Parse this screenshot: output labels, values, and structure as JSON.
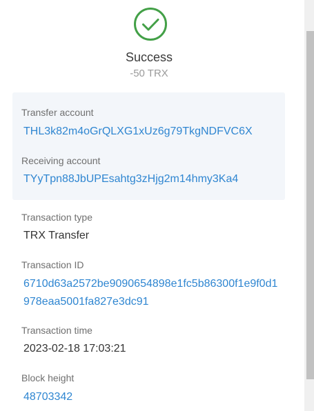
{
  "status": {
    "icon": "check-circle-icon",
    "title": "Success",
    "amount": "-50 TRX",
    "color": "#43a047"
  },
  "accounts": {
    "transfer_label": "Transfer account",
    "transfer_value": "THL3k82m4oGrQLXG1xUz6g79TkgNDFVC6X",
    "receiving_label": "Receiving account",
    "receiving_value": "TYyTpn88JbUPEsahtg3zHjg2m14hmy3Ka4"
  },
  "details": {
    "type_label": "Transaction type",
    "type_value": "TRX Transfer",
    "id_label": "Transaction ID",
    "id_value": "6710d63a2572be9090654898e1fc5b86300f1e9f0d1978eaa5001fa827e3dc91",
    "time_label": "Transaction time",
    "time_value": "2023-02-18 17:03:21",
    "block_label": "Block height",
    "block_value": "48703342"
  },
  "theme": {
    "link_color": "#2f86d1",
    "card_background": "#f3f6fa"
  }
}
